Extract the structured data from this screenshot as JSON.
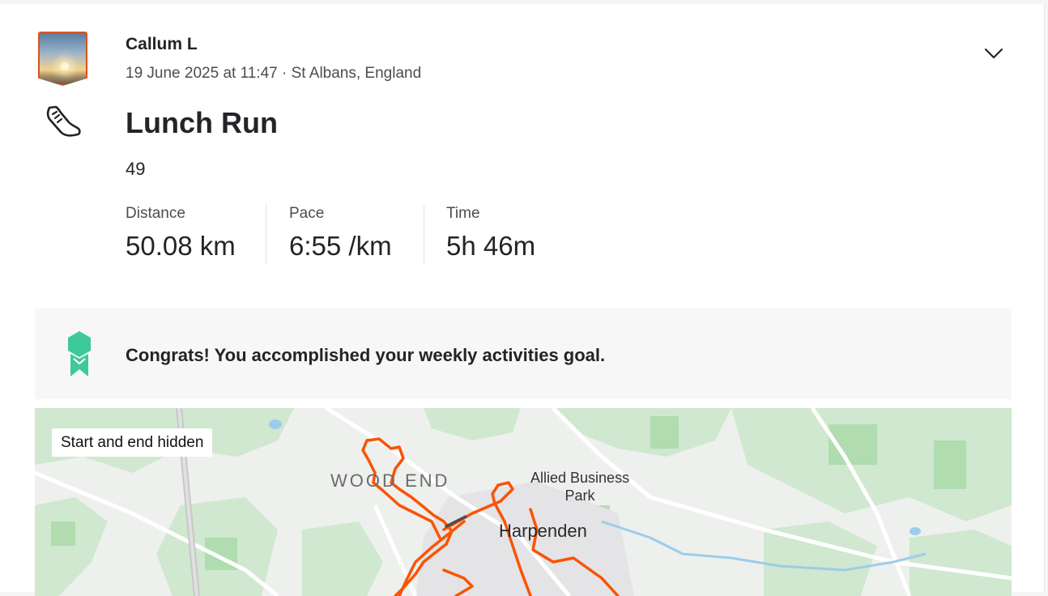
{
  "activity": {
    "athlete_name": "Callum L",
    "date_location": "19 June 2025 at 11:47 · St Albans, England",
    "title": "Lunch Run",
    "kudos_count": "49",
    "sport_icon": "running-shoe-icon",
    "menu_icon": "chevron-down-icon"
  },
  "stats": [
    {
      "label": "Distance",
      "value": "50.08 km"
    },
    {
      "label": "Pace",
      "value": "6:55 /km"
    },
    {
      "label": "Time",
      "value": "5h 46m"
    }
  ],
  "goal": {
    "icon": "goal-badge-icon",
    "text": "Congrats! You accomplished your weekly activities goal.",
    "color": "#3ec99a"
  },
  "map": {
    "privacy_tag": "Start and end hidden",
    "places": {
      "wood_end": "WOOD END",
      "allied_line1": "Allied Business",
      "allied_line2": "Park",
      "harpenden": "Harpenden"
    },
    "route_color": "#fc5200"
  }
}
